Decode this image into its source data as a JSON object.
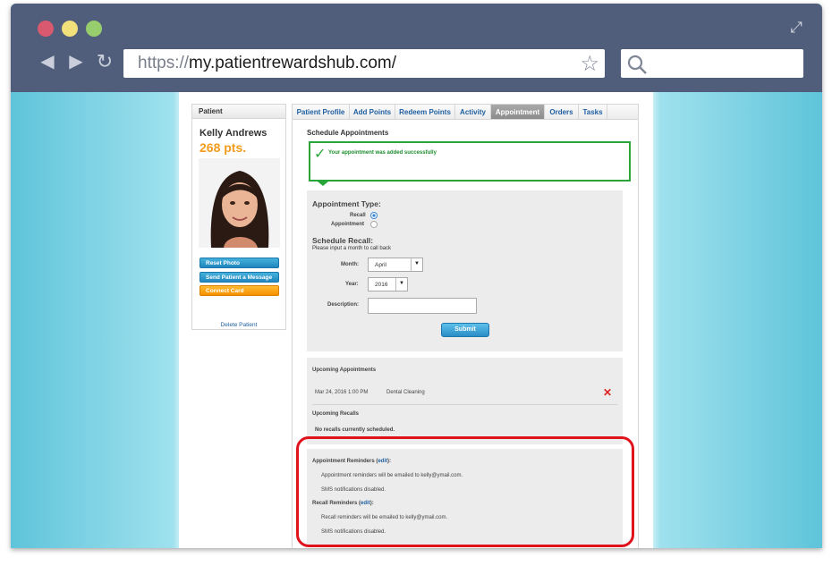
{
  "browser": {
    "url_scheme": "https://",
    "url_host": "my.patientrewardshub.com/",
    "icons": [
      "back-arrow-icon",
      "forward-arrow-icon",
      "reload-icon",
      "bookmark-star-icon",
      "search-icon",
      "expand-icon"
    ]
  },
  "sidebar": {
    "header": "Patient",
    "patient_name": "Kelly Andrews",
    "points": "268 pts.",
    "reset_photo": "Reset Photo",
    "send_message": "Send Patient a Message",
    "connect_card": "Connect Card",
    "delete_patient": "Delete Patient"
  },
  "tabs": [
    "Patient Profile",
    "Add Points",
    "Redeem Points",
    "Activity",
    "Appointment",
    "Orders",
    "Tasks"
  ],
  "active_tab": "Appointment",
  "schedule": {
    "title": "Schedule Appointments",
    "success_message": "Your appointment was added successfully",
    "appointment_type_label": "Appointment Type:",
    "recall_label": "Recall",
    "appointment_label": "Appointment",
    "selected_type": "Recall",
    "schedule_recall_label": "Schedule Recall:",
    "hint": "Please input a month to call back",
    "month_label": "Month:",
    "month_value": "April",
    "year_label": "Year:",
    "year_value": "2016",
    "description_label": "Description:",
    "description_value": "",
    "submit_label": "Submit"
  },
  "upcoming": {
    "appointments_title": "Upcoming Appointments",
    "appointment_date": "Mar 24, 2016 1:00 PM",
    "appointment_desc": "Dental Cleaning",
    "recalls_title": "Upcoming Recalls",
    "recalls_empty": "No recalls currently scheduled."
  },
  "reminders": {
    "appt_title": "Appointment Reminders",
    "edit": "edit",
    "appt_email": "Appointment reminders will be emailed to kelly@ymail.com.",
    "appt_sms": "SMS notifications disabled.",
    "recall_title": "Recall Reminders",
    "recall_email": "Recall reminders will be emailed to kelly@ymail.com.",
    "recall_sms": "SMS notifications disabled."
  },
  "colors": {
    "chrome": "#515e7b",
    "points": "#f49b1c",
    "success": "#29a53a",
    "highlight": "#e0131c",
    "link": "#1f5fa0"
  }
}
